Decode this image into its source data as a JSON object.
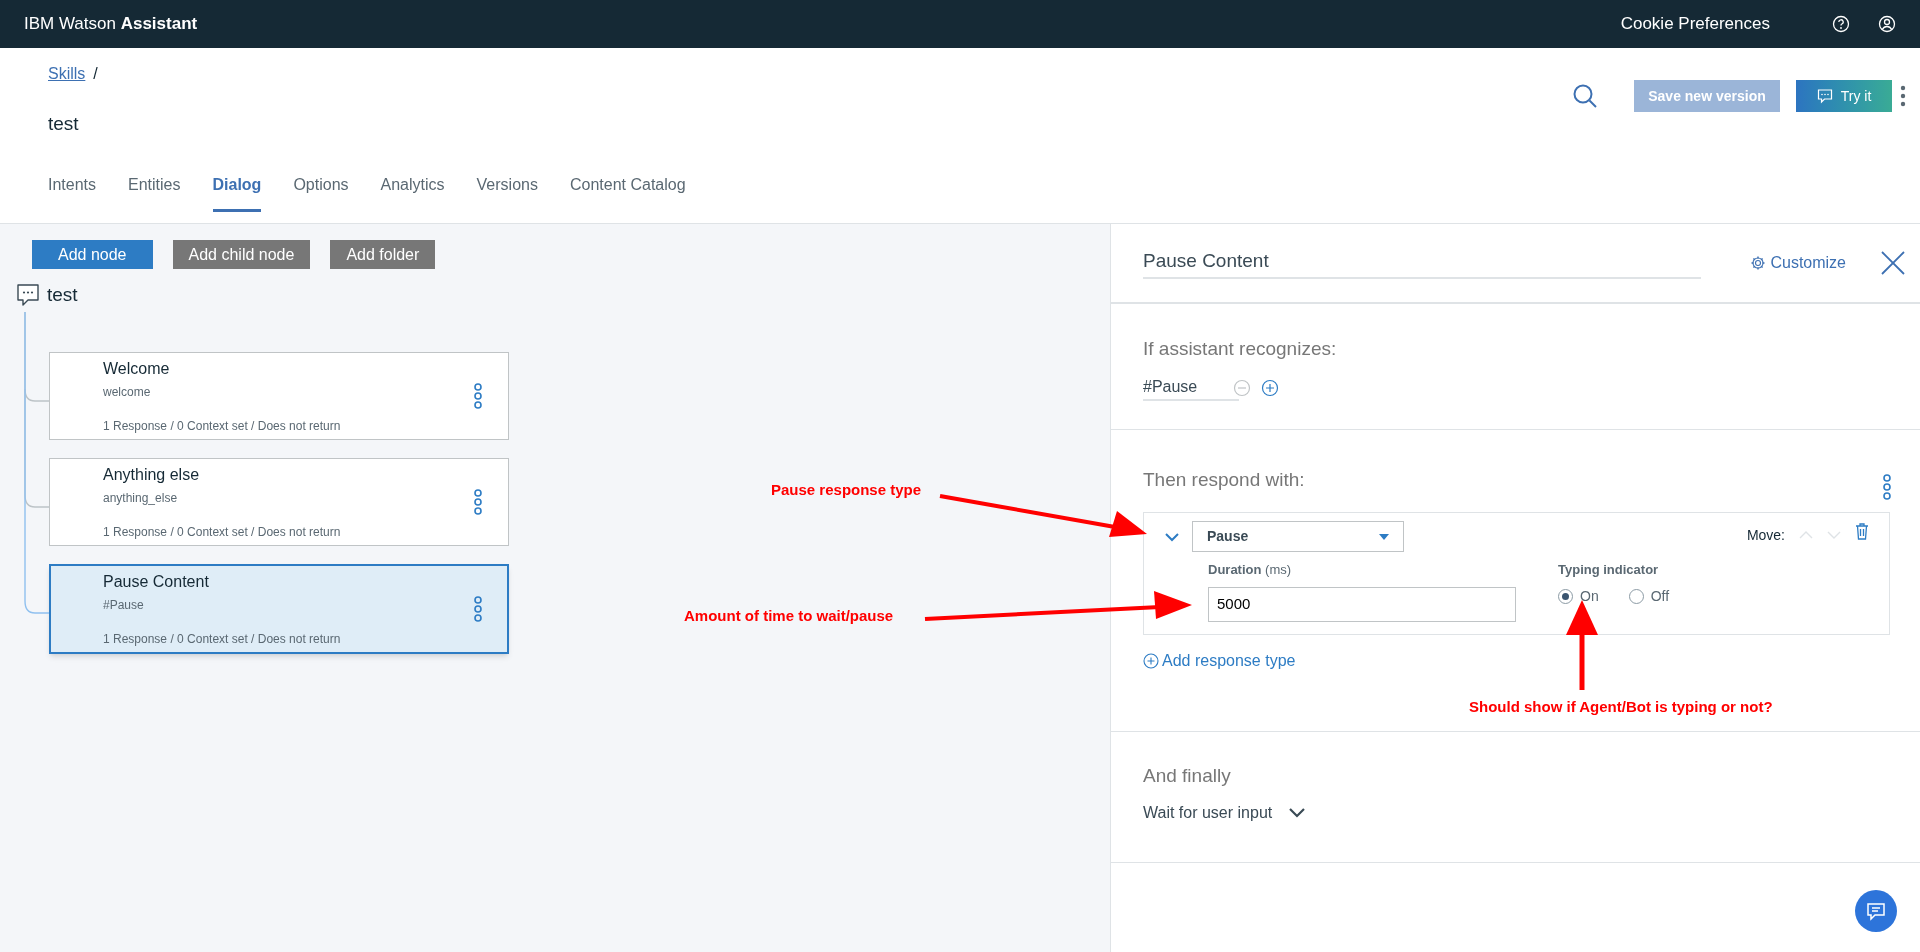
{
  "top_bar": {
    "brand": "IBM Watson",
    "brand_bold": "Assistant",
    "cookie_link": "Cookie Preferences"
  },
  "breadcrumb": {
    "link": "Skills",
    "separator": "/"
  },
  "page_title": "test",
  "toolbar": {
    "save_button": "Save new version",
    "save_disabled": true,
    "try_button": "Try it"
  },
  "tabs": [
    {
      "label": "Intents",
      "selected": false
    },
    {
      "label": "Entities",
      "selected": false
    },
    {
      "label": "Dialog",
      "selected": true
    },
    {
      "label": "Options",
      "selected": false
    },
    {
      "label": "Analytics",
      "selected": false
    },
    {
      "label": "Versions",
      "selected": false
    },
    {
      "label": "Content Catalog",
      "selected": false
    }
  ],
  "dialog_buttons": [
    {
      "label": "Add node",
      "kind": "primary"
    },
    {
      "label": "Add child node",
      "kind": "secondary"
    },
    {
      "label": "Add folder",
      "kind": "secondary"
    }
  ],
  "tree": {
    "root": "test",
    "nodes": [
      {
        "title": "Welcome",
        "condition": "welcome",
        "summary": "1 Response / 0 Context set / Does not return",
        "selected": false
      },
      {
        "title": "Anything else",
        "condition": "anything_else",
        "summary": "1 Response / 0 Context set / Does not return",
        "selected": false
      },
      {
        "title": "Pause Content",
        "condition": "#Pause",
        "summary": "1 Response / 0 Context set / Does not return",
        "selected": true
      }
    ]
  },
  "editor": {
    "name": "Pause Content",
    "customize": "Customize",
    "recognizes_heading": "If assistant recognizes:",
    "condition": "#Pause",
    "respond_heading": "Then respond with:",
    "response": {
      "type": "Pause",
      "move_label": "Move:",
      "duration_label": "Duration",
      "duration_unit": "(ms)",
      "duration_value": "5000",
      "typing_label": "Typing indicator",
      "options": [
        {
          "label": "On",
          "selected": true
        },
        {
          "label": "Off",
          "selected": false
        }
      ]
    },
    "add_response": "Add response type",
    "finally_heading": "And finally",
    "finally_action": "Wait for user input"
  },
  "annotations": [
    {
      "text": "Pause response type"
    },
    {
      "text": "Amount of time to wait/pause"
    },
    {
      "text": "Should show if Agent/Bot is typing or not?"
    }
  ]
}
